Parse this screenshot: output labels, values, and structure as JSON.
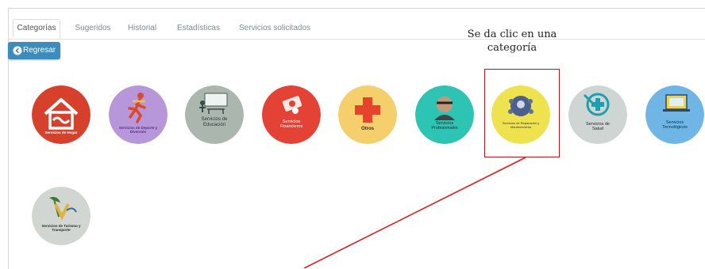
{
  "tabs": [
    {
      "label": "Categorías"
    },
    {
      "label": "Sugeridos"
    },
    {
      "label": "Historial"
    },
    {
      "label": "Estadísticas"
    },
    {
      "label": "Servicios solicitados"
    }
  ],
  "back_button": {
    "label": "Regresar",
    "icon": "arrow-circle-left-icon"
  },
  "annotation": {
    "line1": "Se da clic en una",
    "line2": "categoría"
  },
  "categories": [
    {
      "label": "Servicios de Hogar",
      "color": "#d7402b",
      "icon": "house-handshake-icon"
    },
    {
      "label": "Servicios de Deporte y Diversión",
      "color": "#b797d9",
      "icon": "runner-icon"
    },
    {
      "label": "Servicios de Educación",
      "color": "#aab6ae",
      "icon": "classroom-icon"
    },
    {
      "label": "Servicios Financieros",
      "color": "#e54236",
      "icon": "money-icon"
    },
    {
      "label": "Otros",
      "color": "#f5cf6c",
      "icon": "plus-icon"
    },
    {
      "label": "Servicios Profesionales",
      "color": "#2ec4b3",
      "icon": "professional-icon"
    },
    {
      "label": "Servicios de Reparación y Mantenimiento",
      "color": "#efe24f",
      "icon": "repair-tools-icon"
    },
    {
      "label": "Servicios de Salud",
      "color": "#cfd5d3",
      "icon": "health-cross-icon"
    },
    {
      "label": "Servicios Tecnológicos",
      "color": "#6fb6e6",
      "icon": "tech-icon"
    },
    {
      "label": "Servicios de Turismo y Transporte",
      "color": "#d2d6d2",
      "icon": "tourism-icon"
    }
  ]
}
